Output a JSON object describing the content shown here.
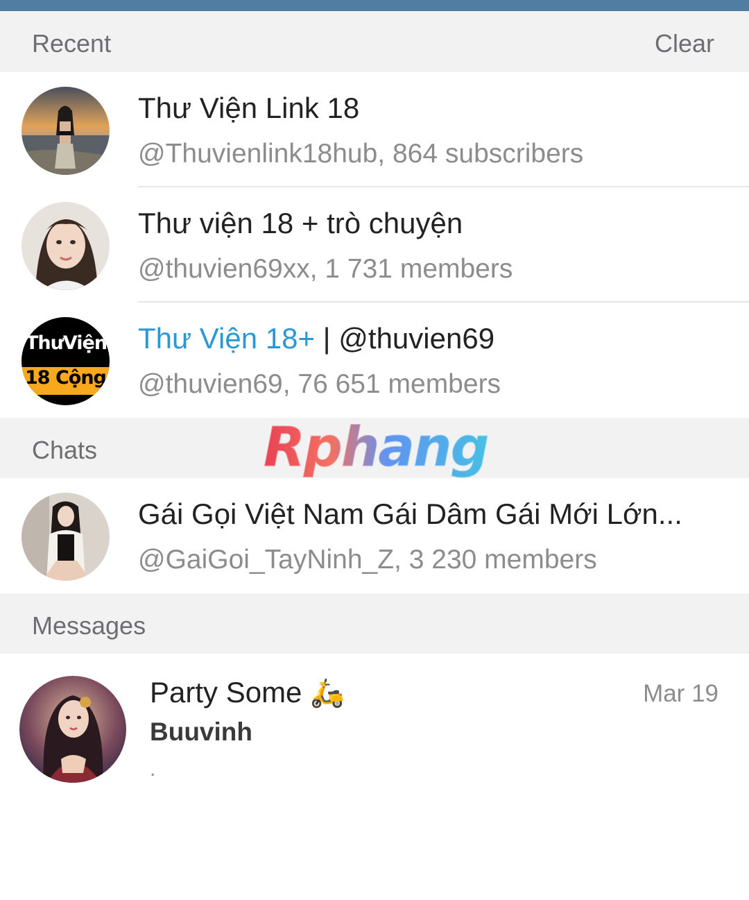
{
  "recent": {
    "title": "Recent",
    "clear_label": "Clear",
    "items": [
      {
        "name": "Thư Viện Link 18",
        "sub": "@Thuvienlink18hub, 864 subscribers"
      },
      {
        "name": "Thư viện 18 + trò chuyện",
        "sub": "@thuvien69xx, 1 731 members"
      },
      {
        "name_highlight": "Thư Viện 18+",
        "name_rest": " | @thuvien69",
        "sub": "@thuvien69, 76 651 members",
        "avatar_text_top": "ThưViện",
        "avatar_text_bottom": "18 Cộng"
      }
    ]
  },
  "chats": {
    "title": "Chats",
    "items": [
      {
        "name": "Gái Gọi Việt Nam Gái Dâm Gái Mới Lớn...",
        "sub": "@GaiGoi_TayNinh_Z, 3 230 members"
      }
    ]
  },
  "messages": {
    "title": "Messages",
    "items": [
      {
        "title": "Party Some",
        "emoji": "🛵",
        "sender": "Buuvinh",
        "text": ".",
        "date": "Mar 19"
      }
    ]
  },
  "watermark": "Rphang",
  "colors": {
    "accent": "#527da3",
    "link_blue": "#2b98d6",
    "section_bg": "#f2f2f3"
  }
}
